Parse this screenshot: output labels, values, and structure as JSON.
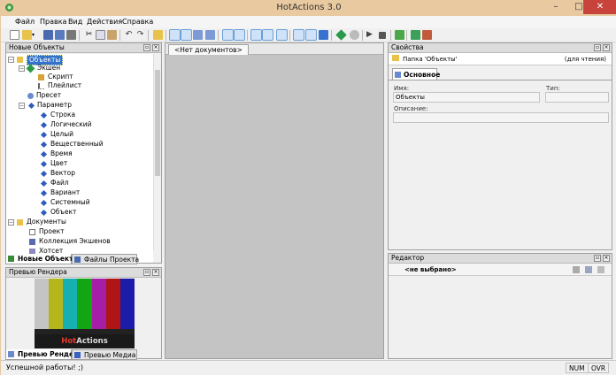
{
  "app": {
    "title": "HotActions 3.0"
  },
  "menu": [
    "Файл",
    "Правка",
    "Вид",
    "Действия",
    "Справка"
  ],
  "left_panel": {
    "title": "Новые Объекты",
    "tree": [
      {
        "label": "Объекты",
        "selected": true
      },
      {
        "label": "Экшен"
      },
      {
        "label": "Скрипт"
      },
      {
        "label": "Плейлист"
      },
      {
        "label": "Пресет"
      },
      {
        "label": "Параметр"
      },
      {
        "label": "Строка"
      },
      {
        "label": "Логический"
      },
      {
        "label": "Целый"
      },
      {
        "label": "Вещественный"
      },
      {
        "label": "Время"
      },
      {
        "label": "Цвет"
      },
      {
        "label": "Вектор"
      },
      {
        "label": "Файл"
      },
      {
        "label": "Вариант"
      },
      {
        "label": "Системный"
      },
      {
        "label": "Объект"
      },
      {
        "label": "Документы"
      },
      {
        "label": "Проект"
      },
      {
        "label": "Коллекция Экшенов"
      },
      {
        "label": "Хотсет"
      }
    ],
    "tabs": [
      "Новые Объекты",
      "Файлы Проекта"
    ]
  },
  "render_panel": {
    "title": "Превью Рендера",
    "logo_hot": "Hot",
    "logo_actions": "Actions",
    "tabs": [
      "Превью Рендера",
      "Превью Медиа"
    ],
    "bar_colors": [
      "#c4c4c4",
      "#b5b51c",
      "#17b0b0",
      "#13a513",
      "#a51ea5",
      "#b01515",
      "#1c1ca8"
    ]
  },
  "center": {
    "tab_label": "<Нет документов>"
  },
  "properties": {
    "title": "Свойства",
    "folder_label": "Папка 'Объекты'",
    "readonly_label": "(для чтения)",
    "tab_main": "Основное",
    "name_label": "Имя:",
    "name_value": "Объекты",
    "type_label": "Тип:",
    "type_value": "",
    "desc_label": "Описание:",
    "desc_value": ""
  },
  "editor": {
    "title": "Редактор",
    "not_selected": "<не выбрано>"
  },
  "status": {
    "message": "Успешной работы! ;)",
    "num": "NUM",
    "ovr": "OVR"
  }
}
